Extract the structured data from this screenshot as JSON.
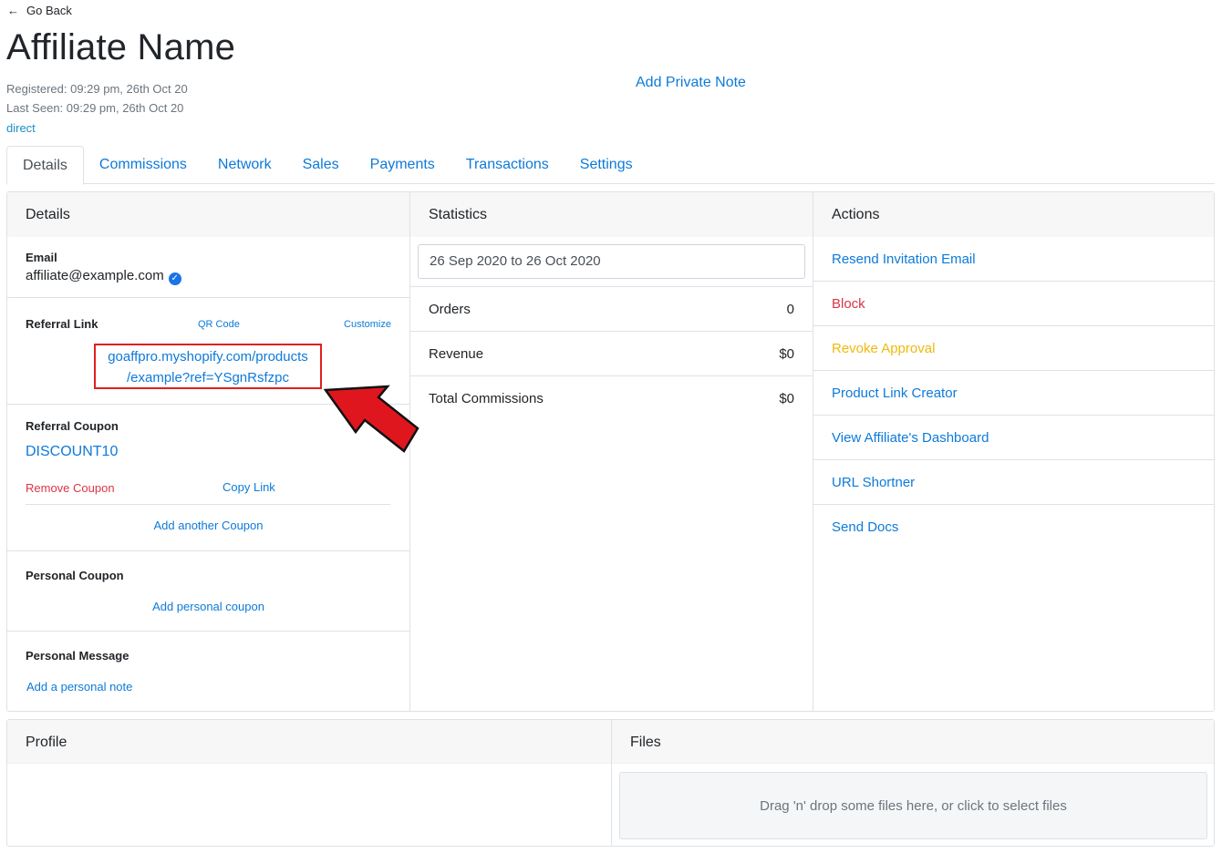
{
  "header": {
    "go_back": "Go Back",
    "title": "Affiliate Name",
    "registered": "Registered: 09:29 pm, 26th Oct 20",
    "last_seen": "Last Seen: 09:29 pm, 26th Oct 20",
    "source": "direct",
    "private_note": "Add Private Note"
  },
  "tabs": [
    {
      "label": "Details",
      "active": true
    },
    {
      "label": "Commissions"
    },
    {
      "label": "Network"
    },
    {
      "label": "Sales"
    },
    {
      "label": "Payments"
    },
    {
      "label": "Transactions"
    },
    {
      "label": "Settings"
    }
  ],
  "details": {
    "heading": "Details",
    "email_label": "Email",
    "email_value": "affiliate@example.com",
    "referral_link_label": "Referral Link",
    "qr_code": "QR Code",
    "customize": "Customize",
    "referral_link_line1": "goaffpro.myshopify.com/products",
    "referral_link_line2": "/example?ref=YSgnRsfzpc",
    "referral_coupon_label": "Referral Coupon",
    "coupon_code": "DISCOUNT10",
    "remove_coupon": "Remove Coupon",
    "copy_link": "Copy Link",
    "add_another_coupon": "Add another Coupon",
    "personal_coupon_label": "Personal Coupon",
    "add_personal_coupon": "Add personal coupon",
    "personal_message_label": "Personal Message",
    "add_personal_note": "Add a personal note"
  },
  "statistics": {
    "heading": "Statistics",
    "date_range": "26 Sep 2020 to 26 Oct 2020",
    "rows": [
      {
        "label": "Orders",
        "value": "0"
      },
      {
        "label": "Revenue",
        "value": "$0"
      },
      {
        "label": "Total Commissions",
        "value": "$0"
      }
    ]
  },
  "actions": {
    "heading": "Actions",
    "items": [
      {
        "label": "Resend Invitation Email",
        "color": "#0d7ad9"
      },
      {
        "label": "Block",
        "color": "#dc3545"
      },
      {
        "label": "Revoke Approval",
        "color": "#f0b90b"
      },
      {
        "label": "Product Link Creator",
        "color": "#0d7ad9"
      },
      {
        "label": "View Affiliate's Dashboard",
        "color": "#0d7ad9"
      },
      {
        "label": "URL Shortner",
        "color": "#0d7ad9"
      },
      {
        "label": "Send Docs",
        "color": "#0d7ad9"
      }
    ]
  },
  "profile": {
    "heading": "Profile"
  },
  "files": {
    "heading": "Files",
    "dropzone": "Drag 'n' drop some files here, or click to select files"
  },
  "colors": {
    "link": "#0d7ad9",
    "danger": "#dc3545",
    "warning": "#f0b90b",
    "highlight": "#e02020"
  },
  "icons": [
    "arrow-left-icon",
    "verified-check-icon",
    "red-pointer-arrow-icon"
  ]
}
